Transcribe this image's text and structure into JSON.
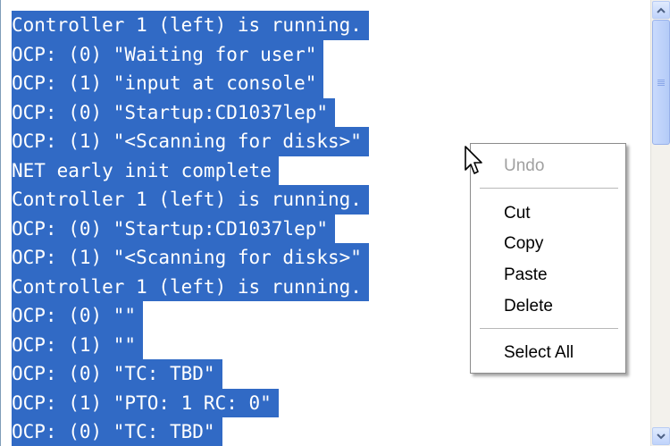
{
  "console": {
    "lines": [
      "Controller 1 (left) is running.",
      "OCP: (0) \"Waiting for user\"",
      "OCP: (1) \"input at console\"",
      "OCP: (0) \"Startup:CD1037lep\"",
      "OCP: (1) \"<Scanning for disks>\"",
      "NET early init complete",
      "Controller 1 (left) is running.",
      "OCP: (0) \"Startup:CD1037lep\"",
      "OCP: (1) \"<Scanning for disks>\"",
      "Controller 1 (left) is running.",
      "OCP: (0) \"\"",
      "OCP: (1) \"\"",
      "OCP: (0) \"TC: TBD\"",
      "OCP: (1) \"PTO: 1 RC: 0\"",
      "OCP: (0) \"TC: TBD\""
    ]
  },
  "context_menu": {
    "undo": "Undo",
    "cut": "Cut",
    "copy": "Copy",
    "paste": "Paste",
    "delete": "Delete",
    "select_all": "Select All"
  },
  "colors": {
    "selection": "#316ac5",
    "scrollbar": "#c1d3fb"
  },
  "icons": {
    "cursor": "arrow-cursor-icon",
    "scroll_up": "arrow-up-icon",
    "scroll_down": "arrow-down-icon"
  }
}
